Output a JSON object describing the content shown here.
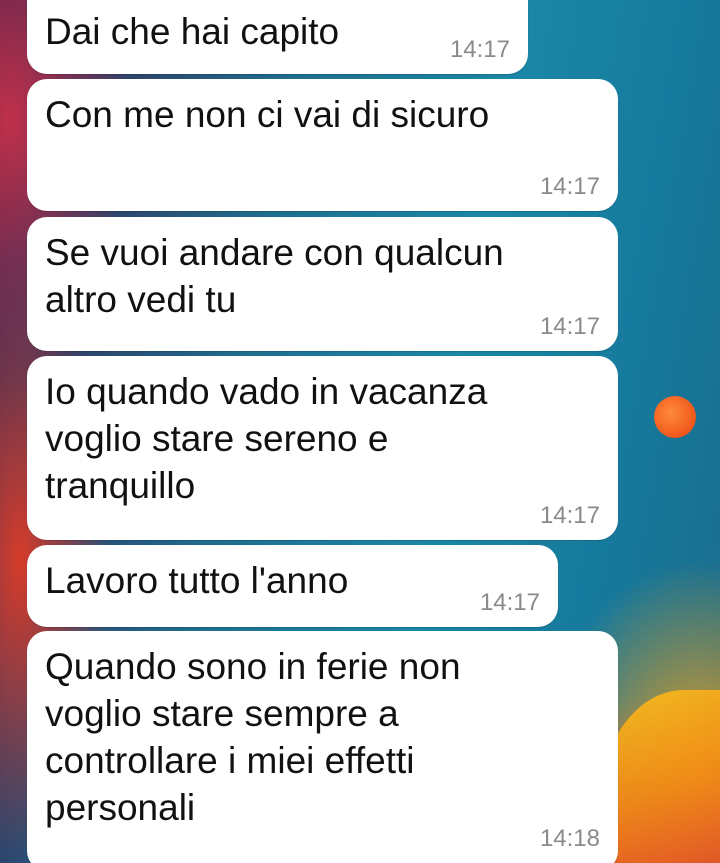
{
  "messages": [
    {
      "text": "Dai che hai capito",
      "time": "14:17"
    },
    {
      "text": "Con me non ci vai di sicuro",
      "time": "14:17"
    },
    {
      "text": "Se vuoi andare con qualcun\naltro vedi tu",
      "time": "14:17"
    },
    {
      "text": "Io quando vado in vacanza\nvoglio stare sereno e\ntranquillo",
      "time": "14:17"
    },
    {
      "text": "Lavoro tutto l'anno",
      "time": "14:17"
    },
    {
      "text": "Quando sono in ferie non\nvoglio stare sempre a\ncontrollare i miei effetti\npersonali",
      "time": "14:18"
    }
  ],
  "colors": {
    "bubble": "#ffffff",
    "text": "#111111",
    "timestamp": "#8a8a8a"
  }
}
